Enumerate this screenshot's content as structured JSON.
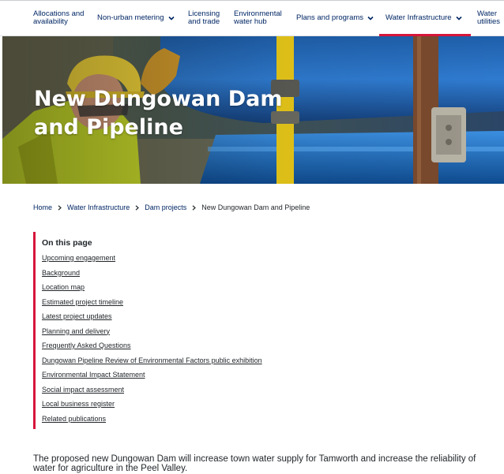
{
  "nav": {
    "items": [
      {
        "label": "Allocations and\navailability",
        "has_chevron": false,
        "active": false
      },
      {
        "label": "Non-urban metering",
        "has_chevron": true,
        "active": false
      },
      {
        "label": "Licensing\nand trade",
        "has_chevron": false,
        "active": false
      },
      {
        "label": "Environmental\nwater hub",
        "has_chevron": false,
        "active": false
      },
      {
        "label": "Plans and programs",
        "has_chevron": true,
        "active": false
      },
      {
        "label": "Water Infrastructure",
        "has_chevron": true,
        "active": true
      },
      {
        "label": "Water\nutilities",
        "has_chevron": false,
        "active": false
      }
    ]
  },
  "hero": {
    "title": "New Dungowan Dam and Pipeline"
  },
  "breadcrumb": {
    "items": [
      "Home",
      "Water Infrastructure",
      "Dam projects"
    ],
    "current": "New Dungowan Dam and Pipeline"
  },
  "on_this_page": {
    "title": "On this page",
    "links": [
      "Upcoming engagement",
      "Background",
      "Location map",
      "Estimated project timeline",
      "Latest project updates",
      "Planning and delivery",
      "Frequently Asked Questions",
      "Dungowan Pipeline Review of Environmental Factors public exhibition",
      "Environmental Impact Statement",
      "Social impact assessment",
      "Local business register",
      "Related publications"
    ]
  },
  "intro": {
    "text": "The proposed new Dungowan Dam will increase town water supply for Tamworth and increase the reliability of water for agriculture in the Peel Valley."
  },
  "colors": {
    "brand_navy": "#002664",
    "accent_red": "#d7153a",
    "text": "#22272b"
  }
}
